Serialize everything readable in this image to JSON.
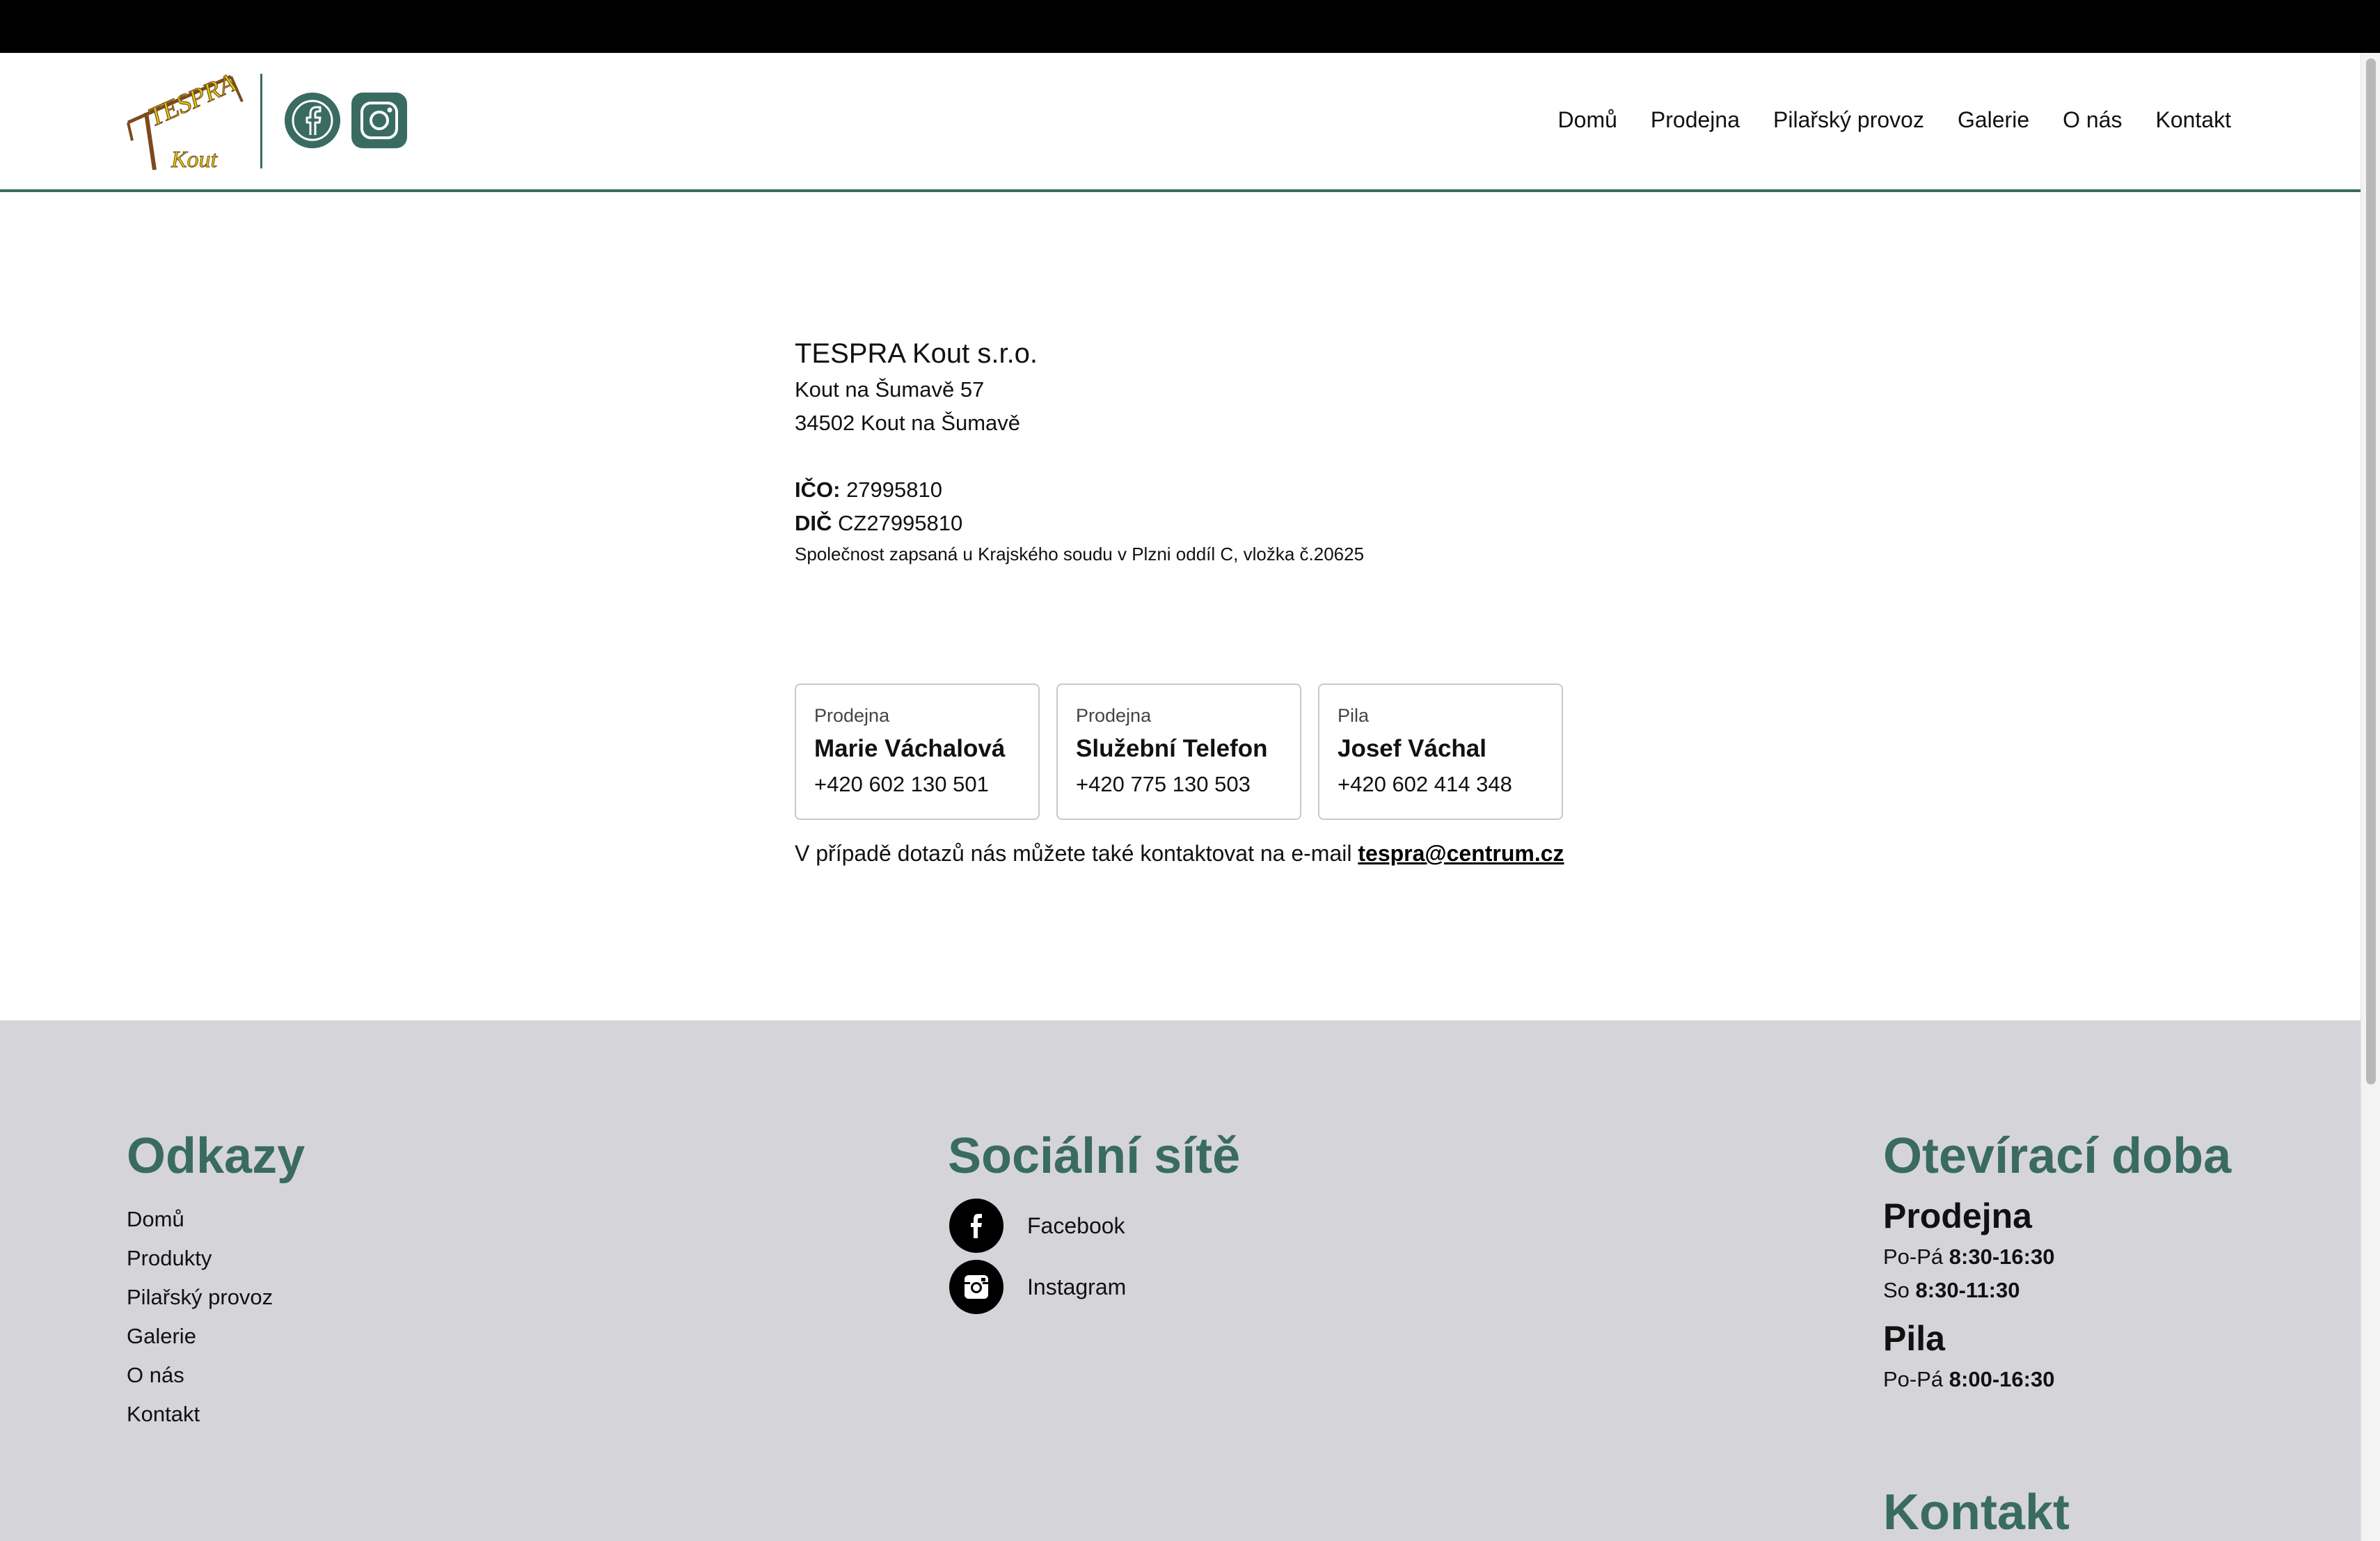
{
  "nav": {
    "items": [
      "Domů",
      "Prodejna",
      "Pilařský provoz",
      "Galerie",
      "O nás",
      "Kontakt"
    ]
  },
  "logo": {
    "text_main": "TESPRA",
    "text_sub": "Kout"
  },
  "company": {
    "name": "TESPRA Kout s.r.o.",
    "address_line1": "Kout na Šumavě 57",
    "address_line2": "34502 Kout na Šumavě",
    "ico_label": "IČO:",
    "ico_value": "27995810",
    "dic_label": "DIČ",
    "dic_value": "CZ27995810",
    "registry": "Společnost zapsaná u Krajského soudu v Plzni oddíl C, vložka č.20625"
  },
  "contacts": [
    {
      "role": "Prodejna",
      "name": "Marie Váchalová",
      "phone": "+420 602 130 501"
    },
    {
      "role": "Prodejna",
      "name": "Služební Telefon",
      "phone": "+420 775 130 503"
    },
    {
      "role": "Pila",
      "name": "Josef Váchal",
      "phone": "+420 602 414 348"
    }
  ],
  "email": {
    "prefix": "V případě dotazů nás můžete také kontaktovat na e-mail",
    "address": "tespra@centrum.cz"
  },
  "footer": {
    "links_title": "Odkazy",
    "links": [
      "Domů",
      "Produkty",
      "Pilařský provoz",
      "Galerie",
      "O nás",
      "Kontakt"
    ],
    "social_title": "Sociální sítě",
    "social": [
      {
        "label": "Facebook",
        "icon": "facebook-icon"
      },
      {
        "label": "Instagram",
        "icon": "instagram-icon"
      }
    ],
    "hours_title": "Otevírací doba",
    "hours": [
      {
        "place": "Prodejna",
        "rows": [
          {
            "days": "Po-Pá",
            "time": "8:30-16:30"
          },
          {
            "days": "So",
            "time": "8:30-11:30"
          }
        ]
      },
      {
        "place": "Pila",
        "rows": [
          {
            "days": "Po-Pá",
            "time": "8:00-16:30"
          }
        ]
      }
    ],
    "contact_title": "Kontakt"
  },
  "colors": {
    "accent": "#3a6b62",
    "footer_bg": "#d5d5d9",
    "logo_yellow": "#d9d400",
    "logo_brown": "#7a4a1e"
  }
}
